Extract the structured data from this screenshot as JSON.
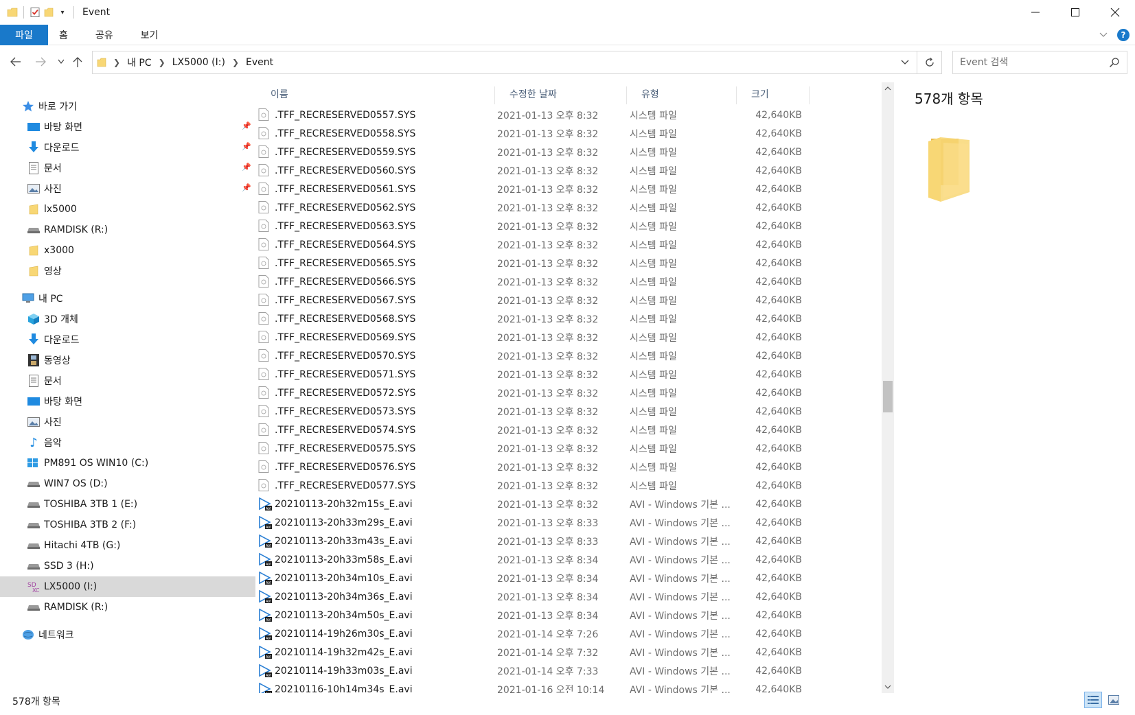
{
  "window": {
    "title": "Event",
    "minimize": "—",
    "maximize": "☐",
    "close": "✕"
  },
  "ribbon": {
    "tabs": [
      "파일",
      "홈",
      "공유",
      "보기"
    ],
    "help": "?"
  },
  "address": {
    "crumbs": [
      "내 PC",
      "LX5000 (I:)",
      "Event"
    ]
  },
  "search": {
    "placeholder": "Event 검색"
  },
  "navpane": {
    "quick_access": "바로 가기",
    "quick_items": [
      "바탕 화면",
      "다운로드",
      "문서",
      "사진",
      "lx5000",
      "RAMDISK (R:)",
      "x3000",
      "영상"
    ],
    "this_pc": "내 PC",
    "pc_items": [
      "3D 개체",
      "다운로드",
      "동영상",
      "문서",
      "바탕 화면",
      "사진",
      "음악",
      "PM891 OS WIN10 (C:)",
      "WIN7 OS (D:)",
      "TOSHIBA 3TB 1 (E:)",
      "TOSHIBA 3TB 2 (F:)",
      "Hitachi 4TB (G:)",
      "SSD 3 (H:)",
      "LX5000 (I:)",
      "RAMDISK (R:)"
    ],
    "network": "네트워크"
  },
  "columns": {
    "name": "이름",
    "date": "수정한 날짜",
    "type": "유형",
    "size": "크기"
  },
  "files": [
    {
      "name": ".TFF_RECRESERVED0557.SYS",
      "date": "2021-01-13 오후 8:32",
      "type": "시스템 파일",
      "size": "42,640KB",
      "kind": "sys"
    },
    {
      "name": ".TFF_RECRESERVED0558.SYS",
      "date": "2021-01-13 오후 8:32",
      "type": "시스템 파일",
      "size": "42,640KB",
      "kind": "sys"
    },
    {
      "name": ".TFF_RECRESERVED0559.SYS",
      "date": "2021-01-13 오후 8:32",
      "type": "시스템 파일",
      "size": "42,640KB",
      "kind": "sys"
    },
    {
      "name": ".TFF_RECRESERVED0560.SYS",
      "date": "2021-01-13 오후 8:32",
      "type": "시스템 파일",
      "size": "42,640KB",
      "kind": "sys"
    },
    {
      "name": ".TFF_RECRESERVED0561.SYS",
      "date": "2021-01-13 오후 8:32",
      "type": "시스템 파일",
      "size": "42,640KB",
      "kind": "sys"
    },
    {
      "name": ".TFF_RECRESERVED0562.SYS",
      "date": "2021-01-13 오후 8:32",
      "type": "시스템 파일",
      "size": "42,640KB",
      "kind": "sys"
    },
    {
      "name": ".TFF_RECRESERVED0563.SYS",
      "date": "2021-01-13 오후 8:32",
      "type": "시스템 파일",
      "size": "42,640KB",
      "kind": "sys"
    },
    {
      "name": ".TFF_RECRESERVED0564.SYS",
      "date": "2021-01-13 오후 8:32",
      "type": "시스템 파일",
      "size": "42,640KB",
      "kind": "sys"
    },
    {
      "name": ".TFF_RECRESERVED0565.SYS",
      "date": "2021-01-13 오후 8:32",
      "type": "시스템 파일",
      "size": "42,640KB",
      "kind": "sys"
    },
    {
      "name": ".TFF_RECRESERVED0566.SYS",
      "date": "2021-01-13 오후 8:32",
      "type": "시스템 파일",
      "size": "42,640KB",
      "kind": "sys"
    },
    {
      "name": ".TFF_RECRESERVED0567.SYS",
      "date": "2021-01-13 오후 8:32",
      "type": "시스템 파일",
      "size": "42,640KB",
      "kind": "sys"
    },
    {
      "name": ".TFF_RECRESERVED0568.SYS",
      "date": "2021-01-13 오후 8:32",
      "type": "시스템 파일",
      "size": "42,640KB",
      "kind": "sys"
    },
    {
      "name": ".TFF_RECRESERVED0569.SYS",
      "date": "2021-01-13 오후 8:32",
      "type": "시스템 파일",
      "size": "42,640KB",
      "kind": "sys"
    },
    {
      "name": ".TFF_RECRESERVED0570.SYS",
      "date": "2021-01-13 오후 8:32",
      "type": "시스템 파일",
      "size": "42,640KB",
      "kind": "sys"
    },
    {
      "name": ".TFF_RECRESERVED0571.SYS",
      "date": "2021-01-13 오후 8:32",
      "type": "시스템 파일",
      "size": "42,640KB",
      "kind": "sys"
    },
    {
      "name": ".TFF_RECRESERVED0572.SYS",
      "date": "2021-01-13 오후 8:32",
      "type": "시스템 파일",
      "size": "42,640KB",
      "kind": "sys"
    },
    {
      "name": ".TFF_RECRESERVED0573.SYS",
      "date": "2021-01-13 오후 8:32",
      "type": "시스템 파일",
      "size": "42,640KB",
      "kind": "sys"
    },
    {
      "name": ".TFF_RECRESERVED0574.SYS",
      "date": "2021-01-13 오후 8:32",
      "type": "시스템 파일",
      "size": "42,640KB",
      "kind": "sys"
    },
    {
      "name": ".TFF_RECRESERVED0575.SYS",
      "date": "2021-01-13 오후 8:32",
      "type": "시스템 파일",
      "size": "42,640KB",
      "kind": "sys"
    },
    {
      "name": ".TFF_RECRESERVED0576.SYS",
      "date": "2021-01-13 오후 8:32",
      "type": "시스템 파일",
      "size": "42,640KB",
      "kind": "sys"
    },
    {
      "name": ".TFF_RECRESERVED0577.SYS",
      "date": "2021-01-13 오후 8:32",
      "type": "시스템 파일",
      "size": "42,640KB",
      "kind": "sys"
    },
    {
      "name": "20210113-20h32m15s_E.avi",
      "date": "2021-01-13 오후 8:32",
      "type": "AVI - Windows 기본 ...",
      "size": "42,640KB",
      "kind": "avi"
    },
    {
      "name": "20210113-20h33m29s_E.avi",
      "date": "2021-01-13 오후 8:33",
      "type": "AVI - Windows 기본 ...",
      "size": "42,640KB",
      "kind": "avi"
    },
    {
      "name": "20210113-20h33m43s_E.avi",
      "date": "2021-01-13 오후 8:33",
      "type": "AVI - Windows 기본 ...",
      "size": "42,640KB",
      "kind": "avi"
    },
    {
      "name": "20210113-20h33m58s_E.avi",
      "date": "2021-01-13 오후 8:34",
      "type": "AVI - Windows 기본 ...",
      "size": "42,640KB",
      "kind": "avi"
    },
    {
      "name": "20210113-20h34m10s_E.avi",
      "date": "2021-01-13 오후 8:34",
      "type": "AVI - Windows 기본 ...",
      "size": "42,640KB",
      "kind": "avi"
    },
    {
      "name": "20210113-20h34m36s_E.avi",
      "date": "2021-01-13 오후 8:34",
      "type": "AVI - Windows 기본 ...",
      "size": "42,640KB",
      "kind": "avi"
    },
    {
      "name": "20210113-20h34m50s_E.avi",
      "date": "2021-01-13 오후 8:34",
      "type": "AVI - Windows 기본 ...",
      "size": "42,640KB",
      "kind": "avi"
    },
    {
      "name": "20210114-19h26m30s_E.avi",
      "date": "2021-01-14 오후 7:26",
      "type": "AVI - Windows 기본 ...",
      "size": "42,640KB",
      "kind": "avi"
    },
    {
      "name": "20210114-19h32m42s_E.avi",
      "date": "2021-01-14 오후 7:32",
      "type": "AVI - Windows 기본 ...",
      "size": "42,640KB",
      "kind": "avi"
    },
    {
      "name": "20210114-19h33m03s_E.avi",
      "date": "2021-01-14 오후 7:33",
      "type": "AVI - Windows 기본 ...",
      "size": "42,640KB",
      "kind": "avi"
    },
    {
      "name": "20210116-10h14m34s_E.avi",
      "date": "2021-01-16 오전 10:14",
      "type": "AVI - Windows 기본 ...",
      "size": "42,640KB",
      "kind": "avi"
    }
  ],
  "preview": {
    "count_label": "578개 항목"
  },
  "status": {
    "count_label": "578개 항목"
  },
  "colors": {
    "accent": "#1979ca",
    "folder": "#f8d775",
    "selected": "#d9d9d9"
  }
}
